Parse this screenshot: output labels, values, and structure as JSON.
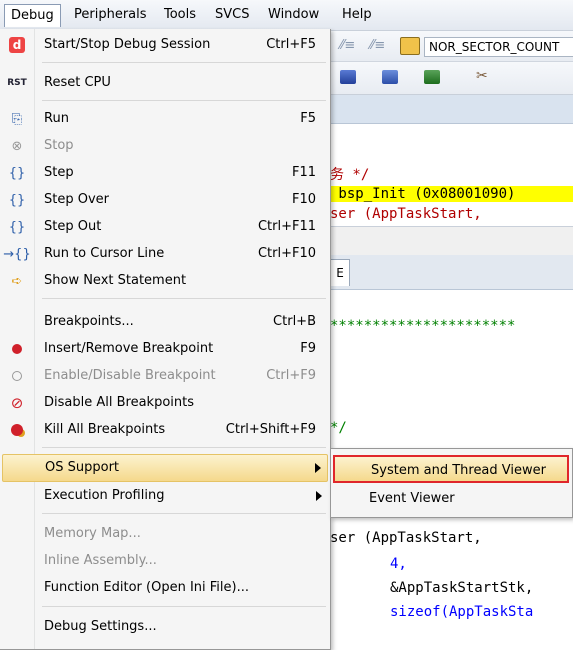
{
  "menubar": {
    "items": [
      "Debug",
      "Peripherals",
      "Tools",
      "SVCS",
      "Window",
      "Help"
    ]
  },
  "background": {
    "toolbar_field": "NOR_SECTOR_COUNT",
    "code_lines": [
      "务 */",
      " bsp_Init (0x08001090)",
      "ser (AppTaskStart,",
      "**********************",
      "*/",
      "ser (AppTaskStart,",
      "4,",
      "&AppTaskStartStk,",
      "sizeof(AppTaskSta"
    ],
    "tab_label": "E",
    "colors": {
      "highlight": "#ffff00",
      "keyword": "#0000ff",
      "comment": "#008000",
      "text_red": "#b00000"
    }
  },
  "menu": {
    "items": [
      {
        "label": "Start/Stop Debug Session",
        "shortcut": "Ctrl+F5",
        "icon": "debug-session-icon"
      },
      {
        "label": "Reset CPU",
        "shortcut": "",
        "icon": "reset-cpu-icon"
      },
      {
        "label": "Run",
        "shortcut": "F5",
        "icon": "run-icon"
      },
      {
        "label": "Stop",
        "shortcut": "",
        "icon": "stop-icon"
      },
      {
        "label": "Step",
        "shortcut": "F11",
        "icon": "step-icon"
      },
      {
        "label": "Step Over",
        "shortcut": "F10",
        "icon": "step-over-icon"
      },
      {
        "label": "Step Out",
        "shortcut": "Ctrl+F11",
        "icon": "step-out-icon"
      },
      {
        "label": "Run to Cursor Line",
        "shortcut": "Ctrl+F10",
        "icon": "run-to-cursor-icon"
      },
      {
        "label": "Show Next Statement",
        "shortcut": "",
        "icon": "next-statement-arrow-icon"
      },
      {
        "label": "Breakpoints...",
        "shortcut": "Ctrl+B",
        "icon": ""
      },
      {
        "label": "Insert/Remove Breakpoint",
        "shortcut": "F9",
        "icon": "breakpoint-icon"
      },
      {
        "label": "Enable/Disable Breakpoint",
        "shortcut": "Ctrl+F9",
        "icon": "breakpoint-outline-icon"
      },
      {
        "label": "Disable All Breakpoints",
        "shortcut": "",
        "icon": "disable-breakpoints-icon"
      },
      {
        "label": "Kill All Breakpoints",
        "shortcut": "Ctrl+Shift+F9",
        "icon": "kill-breakpoints-icon"
      },
      {
        "label": "OS Support",
        "shortcut": "",
        "icon": ""
      },
      {
        "label": "Execution Profiling",
        "shortcut": "",
        "icon": ""
      },
      {
        "label": "Memory Map...",
        "shortcut": "",
        "icon": ""
      },
      {
        "label": "Inline Assembly...",
        "shortcut": "",
        "icon": ""
      },
      {
        "label": "Function Editor (Open Ini File)...",
        "shortcut": "",
        "icon": ""
      },
      {
        "label": "Debug Settings...",
        "shortcut": "",
        "icon": ""
      }
    ]
  },
  "submenu": {
    "items": [
      "System and Thread Viewer",
      "Event Viewer"
    ]
  }
}
